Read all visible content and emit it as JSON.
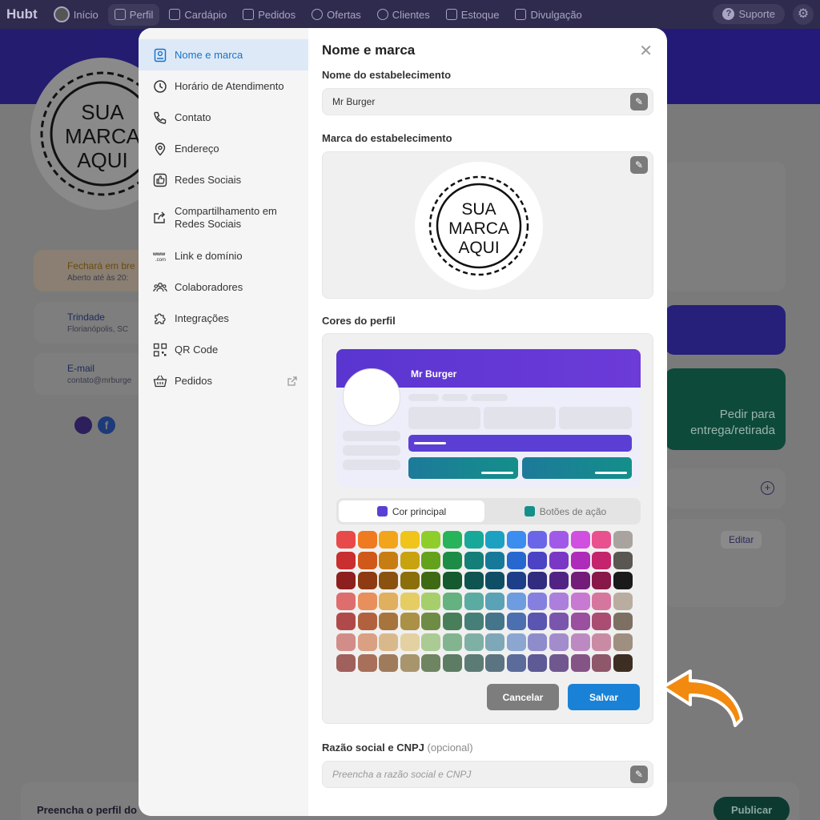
{
  "topbar": {
    "brand": "Hubt",
    "nav": [
      "Início",
      "Perfil",
      "Cardápio",
      "Pedidos",
      "Ofertas",
      "Clientes",
      "Estoque",
      "Divulgação"
    ],
    "suporte": "Suporte"
  },
  "background": {
    "status_title": "Fechará em bre",
    "status_sub": "Aberto até às 20:",
    "address_title": "Trindade",
    "address_sub": "Florianópolis, SC",
    "email_title": "E-mail",
    "email_sub": "contato@mrburge",
    "cta": "Pedir para entrega/retirada",
    "editar": "Editar",
    "footer_text": "Preencha o perfil do",
    "publicar": "Publicar"
  },
  "sidebar": {
    "items": [
      {
        "label": "Nome e marca",
        "icon": "id-card-icon"
      },
      {
        "label": "Horário de Atendimento",
        "icon": "clock-icon"
      },
      {
        "label": "Contato",
        "icon": "phone-icon"
      },
      {
        "label": "Endereço",
        "icon": "pin-icon"
      },
      {
        "label": "Redes Sociais",
        "icon": "thumbs-up-icon"
      },
      {
        "label": "Compartilhamento em Redes Sociais",
        "icon": "share-icon"
      },
      {
        "label": "Link e domínio",
        "icon": "www-icon"
      },
      {
        "label": "Colaboradores",
        "icon": "users-icon"
      },
      {
        "label": "Integrações",
        "icon": "puzzle-icon"
      },
      {
        "label": "QR Code",
        "icon": "qr-icon"
      },
      {
        "label": "Pedidos",
        "icon": "basket-icon"
      }
    ]
  },
  "main": {
    "title": "Nome e marca",
    "nome_label": "Nome do estabelecimento",
    "nome_value": "Mr Burger",
    "marca_label": "Marca do estabelecimento",
    "logo_lines": [
      "SUA",
      "MARCA",
      "AQUI"
    ],
    "cores_label": "Cores do perfil",
    "preview_name": "Mr Burger",
    "tab_principal": "Cor principal",
    "tab_botoes": "Botões de ação",
    "cancel": "Cancelar",
    "save": "Salvar",
    "razao_label": "Razão social e CNPJ",
    "razao_optional": "(opcional)",
    "razao_placeholder": "Preencha a razão social e CNPJ"
  },
  "colors": {
    "accent": "#1a82d6",
    "principal": "#5b3fd4",
    "botoes": "#148f8a",
    "palette": [
      [
        "#e84a4a",
        "#f07a1f",
        "#f2a51a",
        "#f0c419",
        "#8fce2a",
        "#27b35a",
        "#17a89a",
        "#1da1c2",
        "#3b8df0",
        "#6b66e8",
        "#a15ae8",
        "#d14fe0",
        "#e8508e",
        "#a8a39e"
      ],
      [
        "#c92f2f",
        "#d0581a",
        "#c87d12",
        "#c9a20f",
        "#64a21c",
        "#1d8c46",
        "#137f78",
        "#16799a",
        "#2767d0",
        "#4b43c4",
        "#7a36c4",
        "#ae2cb9",
        "#c4246b",
        "#5a5752"
      ],
      [
        "#8e1f1f",
        "#8e3a12",
        "#8a520e",
        "#8a6f0a",
        "#3f6a14",
        "#145a2e",
        "#0e5450",
        "#0f4f66",
        "#1d3f8a",
        "#312c80",
        "#512484",
        "#731c7a",
        "#871848",
        "#1a1a1a"
      ],
      [
        "#de6e6e",
        "#e88f5c",
        "#e0b05f",
        "#e6cd63",
        "#a6cf6b",
        "#63b27f",
        "#5aaca2",
        "#5aa2b6",
        "#6d9de0",
        "#8580df",
        "#ab7fdb",
        "#c879d1",
        "#d6769f",
        "#b9ad9f"
      ],
      [
        "#b04a4a",
        "#b2613e",
        "#a8743e",
        "#ab9145",
        "#6f8c46",
        "#487f5a",
        "#457f77",
        "#44758a",
        "#4c6fb0",
        "#5a55b0",
        "#7a55ad",
        "#9a4f9f",
        "#ab4d72",
        "#7d7063"
      ],
      [
        "#d38d88",
        "#d9a083",
        "#d9b98c",
        "#e3d1a1",
        "#aacb93",
        "#82b58f",
        "#7fb0a5",
        "#7ea7b8",
        "#8aa6d1",
        "#8f8ccc",
        "#a38ccb",
        "#bd89c2",
        "#c98ba3",
        "#9f8f80"
      ],
      [
        "#a0605c",
        "#a8705a",
        "#9f7b5c",
        "#a8956e",
        "#6f8462",
        "#5c7c64",
        "#5c7b74",
        "#5c7482",
        "#5b6b9a",
        "#5d5a95",
        "#70588f",
        "#855487",
        "#8f576a",
        "#3d2e22"
      ]
    ]
  }
}
